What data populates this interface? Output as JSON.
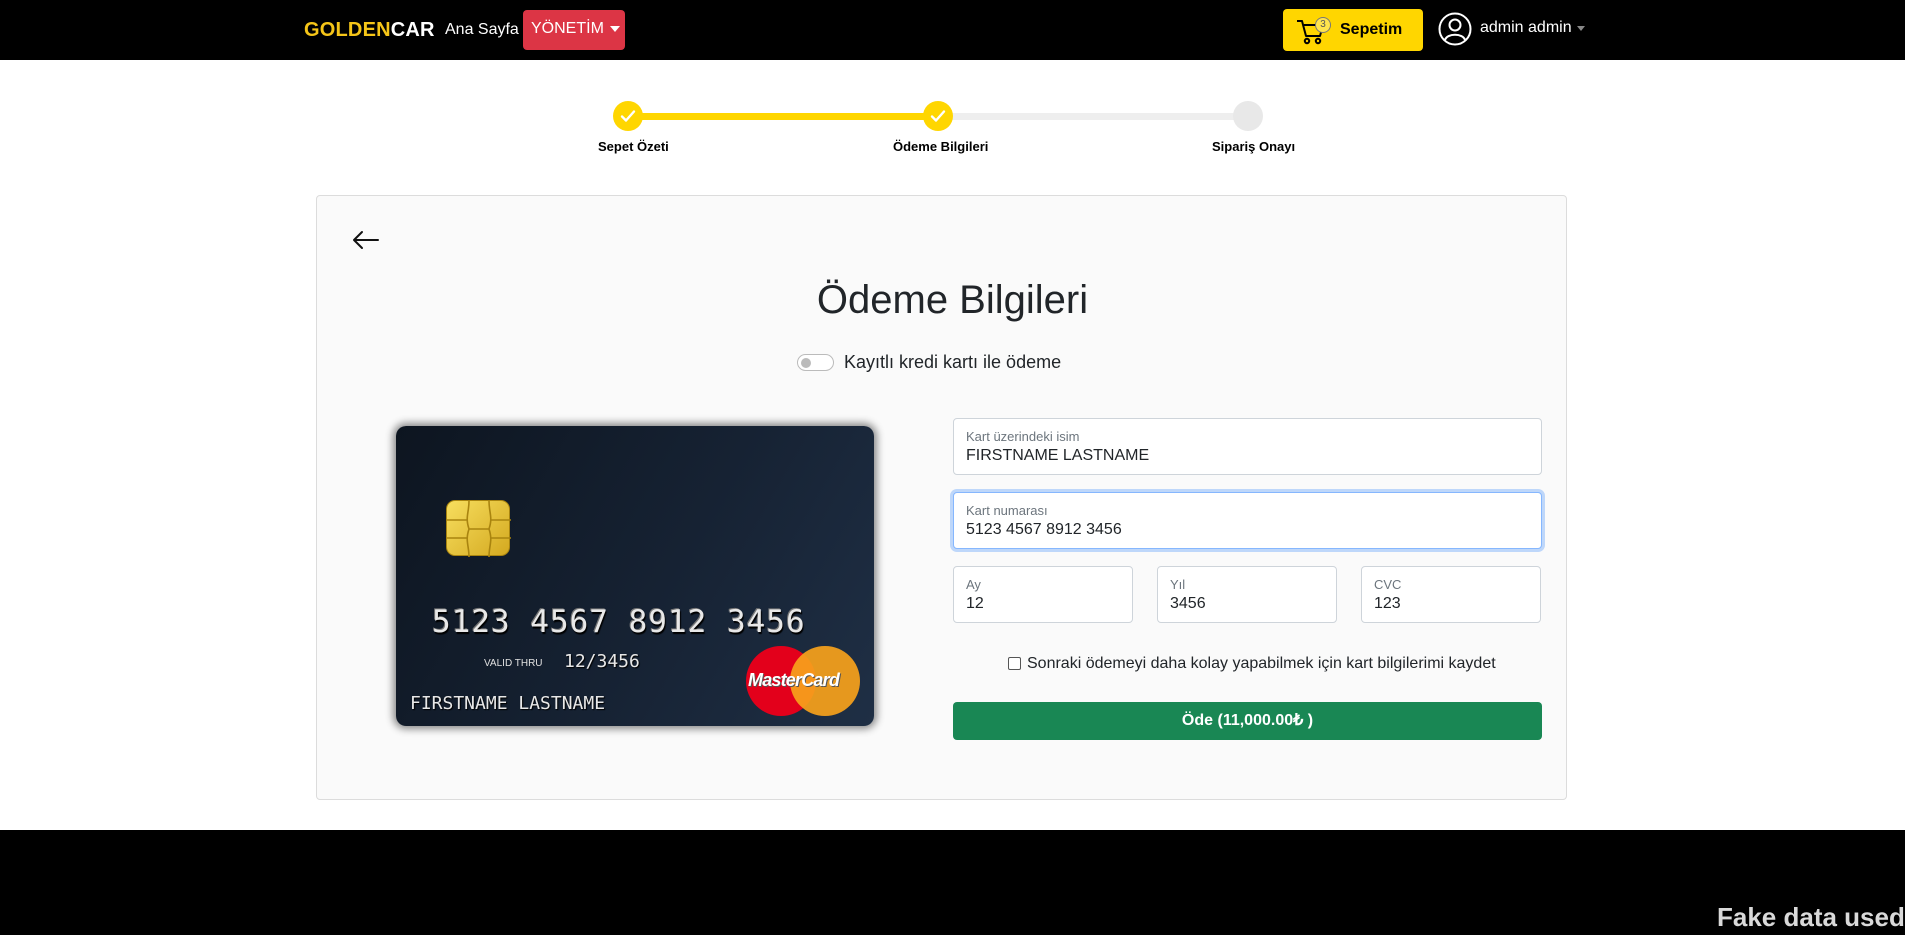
{
  "navbar": {
    "brand_gold": "GOLDEN",
    "brand_white": "CAR",
    "home_link": "Ana Sayfa",
    "admin_dropdown": "YÖNETİM",
    "cart": {
      "label": "Sepetim",
      "count": "3"
    },
    "user": {
      "name": "admin admin"
    }
  },
  "stepper": {
    "steps": [
      {
        "label": "Sepet Özeti",
        "status": "done"
      },
      {
        "label": "Ödeme Bilgileri",
        "status": "done"
      },
      {
        "label": "Sipariş Onayı",
        "status": "pending"
      }
    ]
  },
  "payment": {
    "title": "Ödeme Bilgileri",
    "saved_card_toggle_label": "Kayıtlı kredi kartı ile ödeme",
    "saved_card_toggle_on": false,
    "card_preview": {
      "number": "5123 4567 8912 3456",
      "valid_thru_label": "VALID THRU",
      "valid_thru_value": "12/3456",
      "holder": "FIRSTNAME LASTNAME",
      "brand": "MasterCard"
    },
    "form": {
      "name_label": "Kart üzerindeki isim",
      "name_value": "FIRSTNAME LASTNAME",
      "number_label": "Kart numarası",
      "number_value": "5123 4567 8912 3456",
      "month_label": "Ay",
      "month_value": "12",
      "year_label": "Yıl",
      "year_value": "3456",
      "cvc_label": "CVC",
      "cvc_value": "123",
      "save_card_label": "Sonraki ödemeyi daha kolay yapabilmek için kart bilgilerimi kaydet",
      "save_card_checked": false,
      "pay_button": "Öde (11,000.00₺ )"
    }
  },
  "footer_note": "Fake data used",
  "colors": {
    "brand_gold": "#f5c518",
    "accent_yellow": "#ffd600",
    "admin_red": "#dc3545",
    "pay_green": "#198754"
  },
  "icons": [
    "cart-icon",
    "user-circle-icon",
    "check-icon",
    "back-arrow-icon",
    "chip-icon",
    "mastercard-logo"
  ]
}
